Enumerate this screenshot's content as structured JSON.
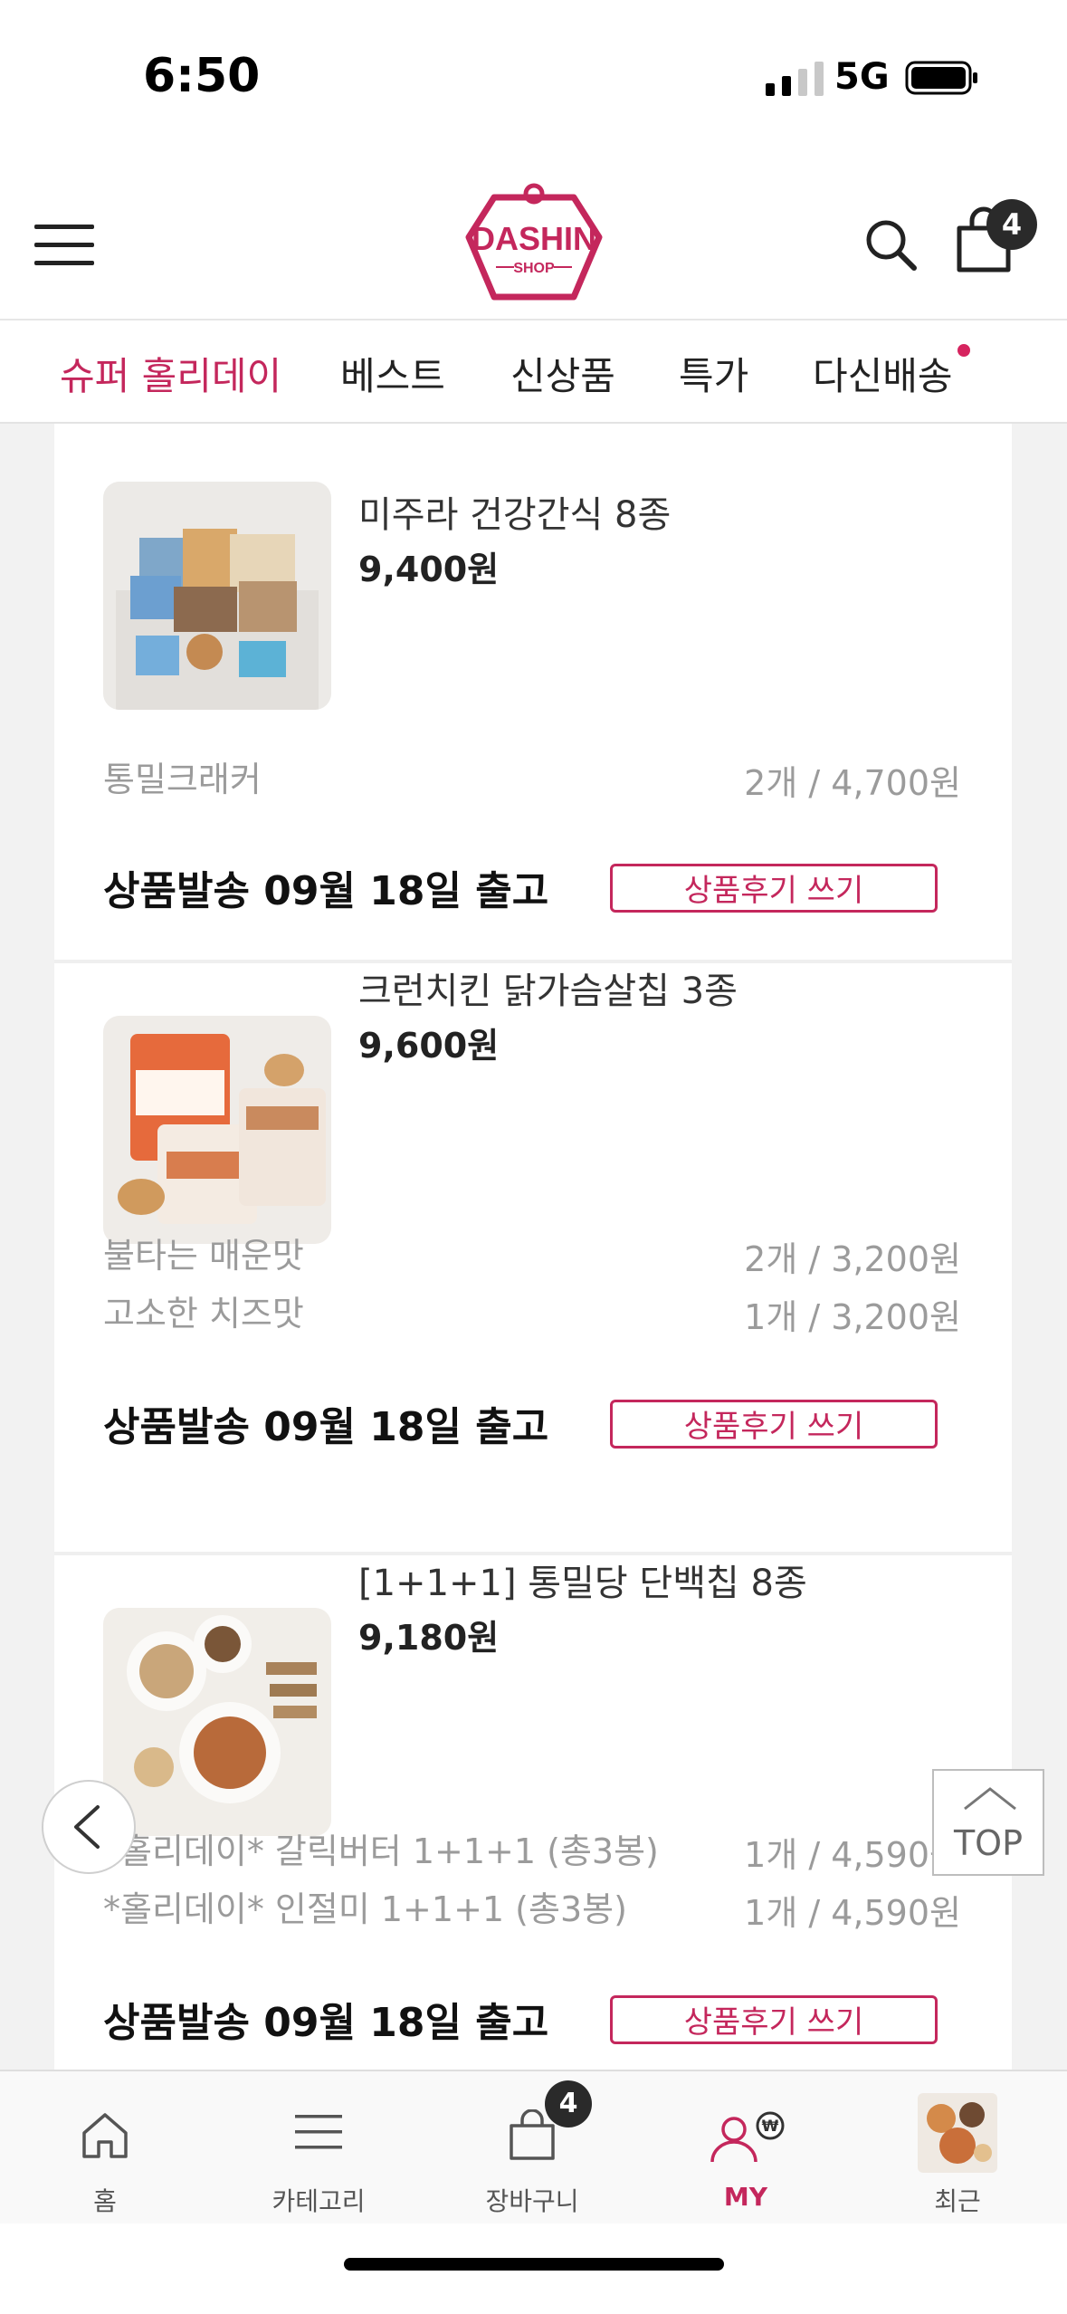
{
  "status_bar": {
    "time": "6:50",
    "network": "5G"
  },
  "header": {
    "logo_text": "DASHIN",
    "logo_sub": "SHOP",
    "cart_count": "4"
  },
  "tabs": [
    {
      "label": "슈퍼 홀리데이",
      "active": true
    },
    {
      "label": "베스트"
    },
    {
      "label": "신상품"
    },
    {
      "label": "특가"
    },
    {
      "label": "다신배송",
      "has_dot": true
    }
  ],
  "products": [
    {
      "name": "미주라 건강간식 8종",
      "price": "9,400원",
      "options": [
        {
          "name": "통밀크래커",
          "qty": "2개 / 4,700원"
        }
      ],
      "shipping": "상품발송  09월 18일 출고",
      "review_label": "상품후기 쓰기"
    },
    {
      "name": "크런치킨 닭가슴살칩 3종",
      "price": "9,600원",
      "options": [
        {
          "name": "불타는 매운맛",
          "qty": "2개 / 3,200원"
        },
        {
          "name": "고소한 치즈맛",
          "qty": "1개 / 3,200원"
        }
      ],
      "shipping": "상품발송  09월 18일 출고",
      "review_label": "상품후기 쓰기"
    },
    {
      "name": "[1+1+1] 통밀당 단백칩 8종",
      "price": "9,180원",
      "options": [
        {
          "name": "*홀리데이* 갈릭버터 1+1+1 (총3봉)",
          "qty": "1개 / 4,590원"
        },
        {
          "name": "*홀리데이* 인절미 1+1+1 (총3봉)",
          "qty": "1개 / 4,590원"
        }
      ],
      "shipping": "상품발송  09월 18일 출고",
      "review_label": "상품후기 쓰기"
    }
  ],
  "top_button": {
    "label": "TOP"
  },
  "bottom_nav": [
    {
      "label": "홈",
      "icon": "home-icon"
    },
    {
      "label": "카테고리",
      "icon": "category-icon"
    },
    {
      "label": "장바구니",
      "icon": "cart-icon",
      "badge": "4"
    },
    {
      "label": "MY",
      "icon": "my-icon",
      "active": true
    },
    {
      "label": "최근",
      "icon": "recent-thumbnail"
    }
  ],
  "colors": {
    "accent": "#c4275c",
    "dot": "#d6245f"
  }
}
